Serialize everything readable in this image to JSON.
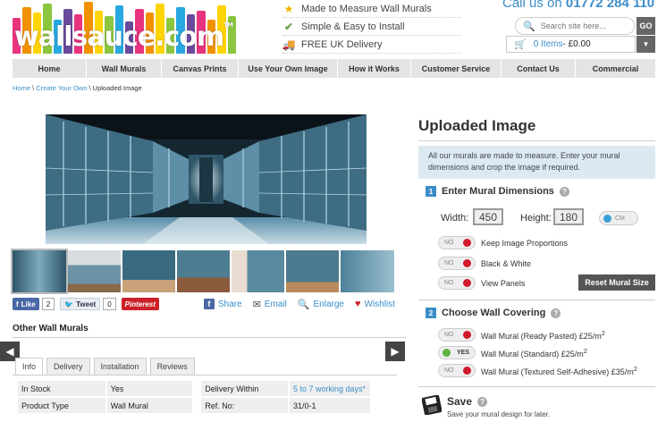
{
  "brand": {
    "name": "wallsauce.com",
    "tm": "TM",
    "bar_colors": [
      "#e8337e",
      "#f29100",
      "#ffd400",
      "#8cc63f",
      "#28a8e0",
      "#6a4a9c",
      "#e8337e",
      "#f29100",
      "#ffd400",
      "#8cc63f",
      "#28a8e0",
      "#6a4a9c",
      "#e8337e",
      "#f29100",
      "#ffd400",
      "#8cc63f",
      "#28a8e0",
      "#6a4a9c",
      "#e8337e",
      "#f29100",
      "#ffd400",
      "#8cc63f"
    ],
    "accent": "#3b8dc8"
  },
  "features": [
    {
      "icon": "star-icon",
      "label": "Made to Measure Wall Murals"
    },
    {
      "icon": "check-icon",
      "label": "Simple & Easy to Install"
    },
    {
      "icon": "truck-icon",
      "label": "FREE UK Delivery"
    }
  ],
  "header": {
    "call_prefix": "Call us on ",
    "call_number": "01772 284 110",
    "search_placeholder": "Search site here...",
    "go_label": "GO",
    "basket_items": "0 Items",
    "basket_total": " - £0.00"
  },
  "nav": [
    {
      "label": "Home"
    },
    {
      "label": "Wall Murals"
    },
    {
      "label": "Canvas Prints"
    },
    {
      "label": "Use Your Own Image"
    },
    {
      "label": "How it Works"
    },
    {
      "label": "Customer Service"
    },
    {
      "label": "Contact Us"
    },
    {
      "label": "Commercial"
    }
  ],
  "breadcrumb": {
    "home": "Home",
    "sep1": " \\ ",
    "create": "Create Your Own",
    "sep2": " \\ ",
    "current": "Uploaded Image"
  },
  "social": {
    "like": "Like",
    "like_count": "2",
    "tweet": "Tweet",
    "tweet_count": "0",
    "pinterest": "Pinterest",
    "share": "Share",
    "email": "Email",
    "enlarge": "Enlarge",
    "wishlist": "Wishlist"
  },
  "other_title": "Other Wall Murals",
  "tabs": [
    {
      "label": "Info",
      "active": true
    },
    {
      "label": "Delivery",
      "active": false
    },
    {
      "label": "Installation",
      "active": false
    },
    {
      "label": "Reviews",
      "active": false
    }
  ],
  "info_table": {
    "in_stock_label": "In Stock",
    "in_stock_value": "Yes",
    "delivery_label": "Delivery Within",
    "delivery_value": "5 to 7 working days*",
    "product_type_label": "Product Type",
    "product_type_value": "Wall Mural",
    "ref_label": "Ref. No:",
    "ref_value": "31/0-1"
  },
  "panel": {
    "title": "Uploaded Image",
    "info": "All our murals are made to measure. Enter your mural dimensions and crop the image if required.",
    "step1_num": "1",
    "step1_title": "Enter Mural Dimensions",
    "width_label": "Width:",
    "width_value": "450",
    "height_label": "Height:",
    "height_value": "180",
    "unit": "CM",
    "options": [
      {
        "state": "NO",
        "label": "Keep Image Proportions"
      },
      {
        "state": "NO",
        "label": "Black & White"
      },
      {
        "state": "NO",
        "label": "View Panels"
      }
    ],
    "reset_label": "Reset Mural Size",
    "step2_num": "2",
    "step2_title": "Choose Wall Covering",
    "coverings": [
      {
        "state": "NO",
        "label": "Wall Mural (Ready Pasted) £25/m",
        "sup": "2",
        "on": false
      },
      {
        "state": "YES",
        "label": "Wall Mural (Standard) £25/m",
        "sup": "2",
        "on": true
      },
      {
        "state": "NO",
        "label": "Wall Mural (Textured Self-Adhesive) £35/m",
        "sup": "2",
        "on": false
      }
    ],
    "save_title": "Save",
    "save_sub": "Save your mural design for later."
  }
}
